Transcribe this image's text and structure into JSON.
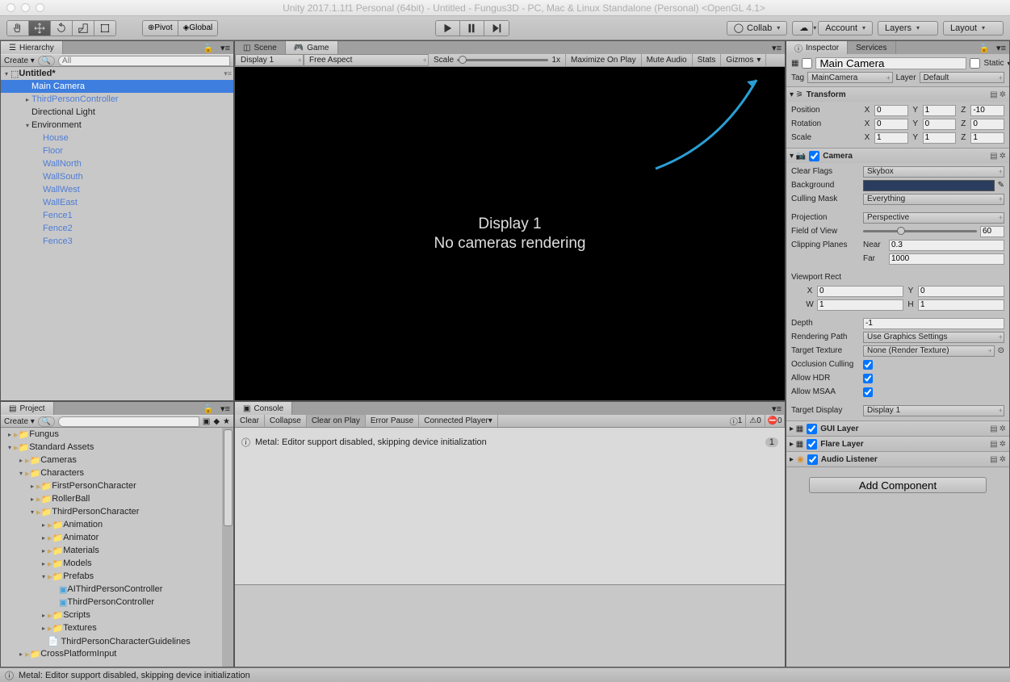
{
  "window": {
    "title": "Unity 2017.1.1f1 Personal (64bit) - Untitled - Fungus3D - PC, Mac & Linux Standalone (Personal) <OpenGL 4.1>"
  },
  "toolbar": {
    "pivot": "Pivot",
    "global": "Global",
    "collab": "Collab",
    "account": "Account",
    "layers": "Layers",
    "layout": "Layout"
  },
  "hierarchy": {
    "tab": "Hierarchy",
    "create": "Create",
    "search_placeholder": "All",
    "root": "Untitled*",
    "items": [
      {
        "name": "Main Camera",
        "indent": 2,
        "selected": true
      },
      {
        "name": "ThirdPersonController",
        "indent": 2,
        "muted": true,
        "twist": "▸"
      },
      {
        "name": "Directional Light",
        "indent": 2
      },
      {
        "name": "Environment",
        "indent": 2,
        "twist": "▾"
      },
      {
        "name": "House",
        "indent": 3,
        "muted": true
      },
      {
        "name": "Floor",
        "indent": 3,
        "muted": true
      },
      {
        "name": "WallNorth",
        "indent": 3,
        "muted": true
      },
      {
        "name": "WallSouth",
        "indent": 3,
        "muted": true
      },
      {
        "name": "WallWest",
        "indent": 3,
        "muted": true
      },
      {
        "name": "WallEast",
        "indent": 3,
        "muted": true
      },
      {
        "name": "Fence1",
        "indent": 3,
        "muted": true
      },
      {
        "name": "Fence2",
        "indent": 3,
        "muted": true
      },
      {
        "name": "Fence3",
        "indent": 3,
        "muted": true
      }
    ]
  },
  "gameview": {
    "tab_scene": "Scene",
    "tab_game": "Game",
    "display": "Display 1",
    "aspect": "Free Aspect",
    "scale_label": "Scale",
    "scale_value": "1x",
    "maximize": "Maximize On Play",
    "mute": "Mute Audio",
    "stats": "Stats",
    "gizmos": "Gizmos",
    "vp_line1": "Display 1",
    "vp_line2": "No cameras rendering"
  },
  "console": {
    "tab": "Console",
    "clear": "Clear",
    "collapse": "Collapse",
    "clear_on_play": "Clear on Play",
    "error_pause": "Error Pause",
    "connected": "Connected Player",
    "msg": "Metal: Editor support disabled, skipping device initialization",
    "info_count": "1",
    "warn_count": "0",
    "err_count": "0",
    "row_count": "1"
  },
  "project": {
    "tab": "Project",
    "create": "Create",
    "items": [
      {
        "name": "Fungus",
        "indent": 0,
        "icon": "folder",
        "twist": "▸"
      },
      {
        "name": "Standard Assets",
        "indent": 0,
        "icon": "folder",
        "twist": "▾"
      },
      {
        "name": "Cameras",
        "indent": 1,
        "icon": "folder",
        "twist": "▸"
      },
      {
        "name": "Characters",
        "indent": 1,
        "icon": "folder",
        "twist": "▾"
      },
      {
        "name": "FirstPersonCharacter",
        "indent": 2,
        "icon": "folder",
        "twist": "▸"
      },
      {
        "name": "RollerBall",
        "indent": 2,
        "icon": "folder",
        "twist": "▸"
      },
      {
        "name": "ThirdPersonCharacter",
        "indent": 2,
        "icon": "folder",
        "twist": "▾"
      },
      {
        "name": "Animation",
        "indent": 3,
        "icon": "folder",
        "twist": "▸"
      },
      {
        "name": "Animator",
        "indent": 3,
        "icon": "folder",
        "twist": "▸"
      },
      {
        "name": "Materials",
        "indent": 3,
        "icon": "folder",
        "twist": "▸"
      },
      {
        "name": "Models",
        "indent": 3,
        "icon": "folder",
        "twist": "▸"
      },
      {
        "name": "Prefabs",
        "indent": 3,
        "icon": "folder",
        "twist": "▾"
      },
      {
        "name": "AIThirdPersonController",
        "indent": 4,
        "icon": "prefab"
      },
      {
        "name": "ThirdPersonController",
        "indent": 4,
        "icon": "prefab"
      },
      {
        "name": "Scripts",
        "indent": 3,
        "icon": "folder",
        "twist": "▸"
      },
      {
        "name": "Textures",
        "indent": 3,
        "icon": "folder",
        "twist": "▸"
      },
      {
        "name": "ThirdPersonCharacterGuidelines",
        "indent": 3,
        "icon": "doc"
      },
      {
        "name": "CrossPlatformInput",
        "indent": 1,
        "icon": "folder",
        "twist": "▸"
      }
    ]
  },
  "inspector": {
    "tab_inspector": "Inspector",
    "tab_services": "Services",
    "object_name": "Main Camera",
    "static_label": "Static",
    "tag_label": "Tag",
    "tag_value": "MainCamera",
    "layer_label": "Layer",
    "layer_value": "Default",
    "transform": {
      "title": "Transform",
      "position_label": "Position",
      "rotation_label": "Rotation",
      "scale_label": "Scale",
      "pos": {
        "x": "0",
        "y": "1",
        "z": "-10"
      },
      "rot": {
        "x": "0",
        "y": "0",
        "z": "0"
      },
      "scl": {
        "x": "1",
        "y": "1",
        "z": "1"
      }
    },
    "camera": {
      "title": "Camera",
      "clear_flags_label": "Clear Flags",
      "clear_flags": "Skybox",
      "background_label": "Background",
      "culling_label": "Culling Mask",
      "culling": "Everything",
      "projection_label": "Projection",
      "projection": "Perspective",
      "fov_label": "Field of View",
      "fov": "60",
      "clipping_label": "Clipping Planes",
      "near_label": "Near",
      "near": "0.3",
      "far_label": "Far",
      "far": "1000",
      "viewport_label": "Viewport Rect",
      "vx": "0",
      "vy": "0",
      "vw": "1",
      "vh": "1",
      "depth_label": "Depth",
      "depth": "-1",
      "rendering_path_label": "Rendering Path",
      "rendering_path": "Use Graphics Settings",
      "target_texture_label": "Target Texture",
      "target_texture": "None (Render Texture)",
      "occlusion_label": "Occlusion Culling",
      "hdr_label": "Allow HDR",
      "msaa_label": "Allow MSAA",
      "target_display_label": "Target Display",
      "target_display": "Display 1"
    },
    "gui_layer": "GUI Layer",
    "flare_layer": "Flare Layer",
    "audio_listener": "Audio Listener",
    "add_component": "Add Component"
  },
  "statusbar": {
    "msg": "Metal: Editor support disabled, skipping device initialization"
  }
}
